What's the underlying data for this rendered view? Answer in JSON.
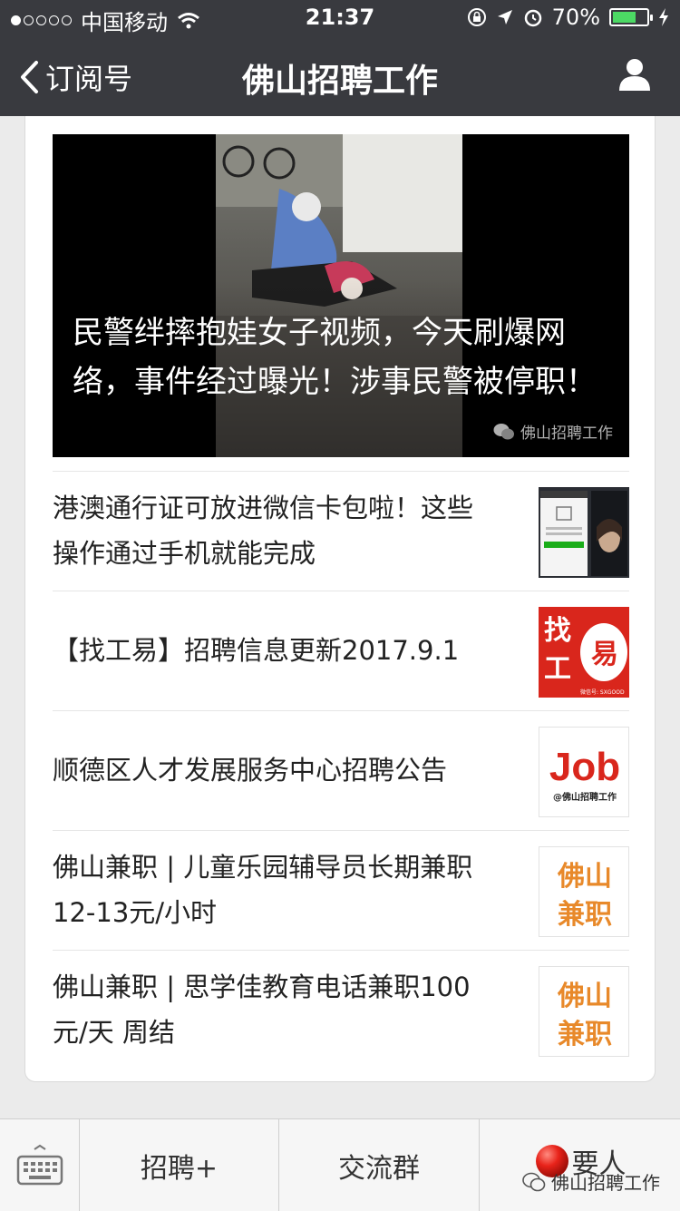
{
  "status_bar": {
    "carrier": "中国移动",
    "time": "21:37",
    "battery": "70%",
    "battery_level": 0.7
  },
  "nav": {
    "back_label": "订阅号",
    "title": "佛山招聘工作"
  },
  "hero": {
    "title": "民警绊摔抱娃女子视频，今天刷爆网络，事件经过曝光！涉事民警被停职！",
    "watermark": "佛山招聘工作"
  },
  "articles": [
    {
      "title": "港澳通行证可放进微信卡包啦！这些操作通过手机就能完成"
    },
    {
      "title": "【找工易】招聘信息更新2017.9.1",
      "thumb_text": [
        "找",
        "工",
        "易"
      ],
      "thumb_caption": "微信号: SXGOOD"
    },
    {
      "title": "顺德区人才发展服务中心招聘公告",
      "thumb_text": "Job",
      "thumb_caption": "@佛山招聘工作"
    },
    {
      "title": "佛山兼职 | 儿童乐园辅导员长期兼职 12-13元/小时",
      "thumb_text": [
        "佛山",
        "兼职"
      ]
    },
    {
      "title": "佛山兼职 | 思学佳教育电话兼职100元/天 周结",
      "thumb_text": [
        "佛山",
        "兼职"
      ]
    }
  ],
  "bottom_bar": {
    "tabs": [
      "招聘+",
      "交流群",
      "要人"
    ]
  },
  "corner_watermark": "佛山招聘工作",
  "colors": {
    "nav_bg": "#393a3f",
    "accent_red": "#d9261c",
    "orange": "#e8892a",
    "battery_green": "#4cd964"
  }
}
